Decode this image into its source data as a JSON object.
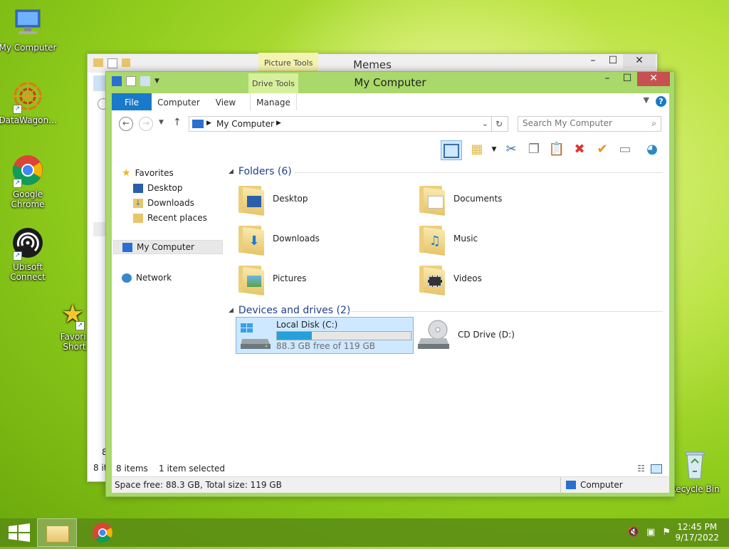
{
  "desktop": {
    "icons": [
      {
        "label": "My Computer"
      },
      {
        "label": "DataWagon..."
      },
      {
        "label": "Google Chrome"
      },
      {
        "label": "Ubisoft Connect"
      },
      {
        "label": "Favori... Short..."
      },
      {
        "label": "Recycle Bin"
      }
    ]
  },
  "back_window": {
    "title": "Memes",
    "context_tab": "Picture Tools",
    "status_partial": "8 it",
    "partial_8": "8"
  },
  "window": {
    "title": "My Computer",
    "context_tab": "Drive Tools",
    "ribbon_tabs": [
      "File",
      "Computer",
      "View",
      "Manage"
    ],
    "address": {
      "root_icon": "computer-icon",
      "path": "My Computer"
    },
    "search": {
      "placeholder": "Search My Computer"
    },
    "nav": {
      "favorites": "Favorites",
      "desktop": "Desktop",
      "downloads": "Downloads",
      "recent": "Recent places",
      "computer": "My Computer",
      "network": "Network"
    },
    "folders_group": "Folders (6)",
    "folders": [
      {
        "name": "Desktop",
        "badge": "desktop"
      },
      {
        "name": "Documents",
        "badge": "documents"
      },
      {
        "name": "Downloads",
        "badge": "download-arrow"
      },
      {
        "name": "Music",
        "badge": "music-note"
      },
      {
        "name": "Pictures",
        "badge": "picture"
      },
      {
        "name": "Videos",
        "badge": "film"
      }
    ],
    "devices_group": "Devices and drives (2)",
    "drives": [
      {
        "name": "Local Disk (C:)",
        "free": "88.3 GB free of 119 GB",
        "used_fraction": 0.258
      },
      {
        "name": "CD Drive (D:)"
      }
    ],
    "status": {
      "items": "8 items",
      "selected": "1 item selected"
    },
    "details": {
      "space": "Space free: 88.3 GB, Total size: 119 GB",
      "location": "Computer"
    }
  },
  "taskbar": {
    "time": "12:45 PM",
    "date": "9/17/2022"
  },
  "colors": {
    "accent": "#1979ca",
    "window_frame": "#a9d86b",
    "selection": "#cde8ff",
    "progress": "#26a0da"
  }
}
